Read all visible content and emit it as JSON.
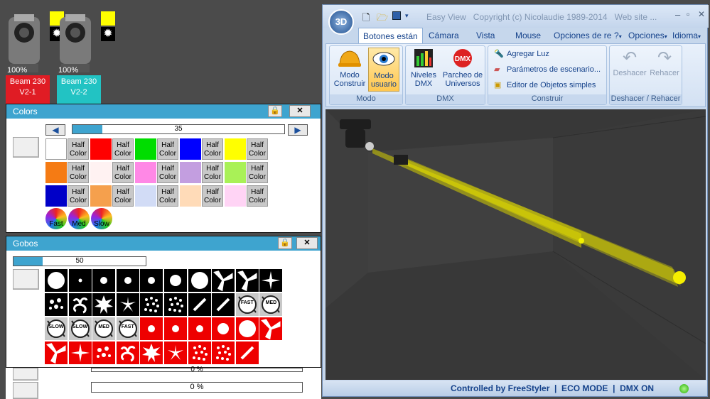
{
  "fixtures": [
    {
      "percent": "100%",
      "name": "Beam 230",
      "id": "V2-1",
      "color": "#e01c24",
      "icon": "moving-head-icon"
    },
    {
      "percent": "100%",
      "name": "Beam 230",
      "id": "V2-2",
      "color": "#22c3c3",
      "icon": "moving-head-icon"
    }
  ],
  "colors_panel": {
    "title": "Colors",
    "slider_value": "35",
    "slider_fraction": 0.14,
    "half_label": "Half\nColor",
    "row1": [
      "#ffffff",
      "#ff0000",
      "#00dd00",
      "#0000ff",
      "#ffff00"
    ],
    "row2": [
      "#f57b14",
      "#fff2f2",
      "#ff88e6",
      "#c39ee0",
      "#a9f157"
    ],
    "row3": [
      "#0000c8",
      "#f5a04d",
      "#d2dcf6",
      "#ffdbb8",
      "#ffd4f5"
    ],
    "speeds": [
      "Fast",
      "Med",
      "Slow"
    ]
  },
  "gobos_panel": {
    "title": "Gobos",
    "slider_value": "50",
    "slider_fraction": 0.22,
    "speed_labels": [
      "FAST",
      "MED",
      "SLOW",
      "SLOW",
      "MED",
      "FAST"
    ]
  },
  "lower_bars": [
    "0 %",
    "0 %"
  ],
  "window": {
    "quick_title": "Easy View   Copyright (c) Nicolaudie 1989-2014   Web site ...",
    "tabs": [
      "Botones están",
      "Cámara",
      "Vista",
      "Mouse",
      "Opciones de re"
    ],
    "right_tabs": [
      "?",
      "Opciones",
      "Idioma"
    ],
    "groups": {
      "modo": {
        "title": "Modo",
        "btn1": "Modo\nConstruir",
        "btn2": "Modo\nusuario"
      },
      "dmx": {
        "title": "DMX",
        "btn1": "Niveles\nDMX",
        "btn2": "Parcheo de\nUniversos"
      },
      "construir": {
        "title": "Construir",
        "items": [
          "Agregar Luz",
          "Parámetros de escenario...",
          "Editor de Objetos simples"
        ]
      },
      "undo": {
        "title": "Deshacer / Rehacer",
        "btn1": "Deshacer",
        "btn2": "Rehacer"
      }
    },
    "status": "Controlled by FreeStyler  |  ECO MODE  |  DMX ON"
  }
}
